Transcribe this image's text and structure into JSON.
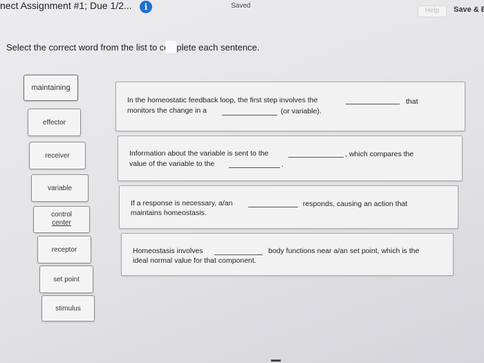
{
  "header": {
    "title": "nect Assignment #1; Due 1/2...",
    "info_icon": "info-icon",
    "status": "Saved",
    "help_label": "Help",
    "save_exit_label": "Save & E"
  },
  "instruction": "Select the correct word from the list to complete each sentence.",
  "word_bank": {
    "items": [
      {
        "label": "maintaining"
      },
      {
        "label": "effector"
      },
      {
        "label": "receiver"
      },
      {
        "label": "variable"
      },
      {
        "label_line1": "control",
        "label_line2": "center"
      },
      {
        "label": "receptor"
      },
      {
        "label": "set point"
      },
      {
        "label": "stimulus"
      }
    ]
  },
  "sentences": [
    {
      "part1": "In the homeostatic feedback loop, the first step involves the",
      "part2": "that",
      "part3": "monitors the change in a",
      "part4": "(or variable)."
    },
    {
      "part1": "Information about the variable is sent to the",
      "part2": ", which compares the",
      "part3": "value of the variable to the",
      "part4": "."
    },
    {
      "part1": "If a response is necessary, a/an",
      "part2": "responds, causing an action that",
      "part3": "maintains homeostasis."
    },
    {
      "part1": "Homeostasis involves",
      "part2": "body functions near a/an set point, which is the",
      "part3": "ideal normal value for that component."
    }
  ]
}
